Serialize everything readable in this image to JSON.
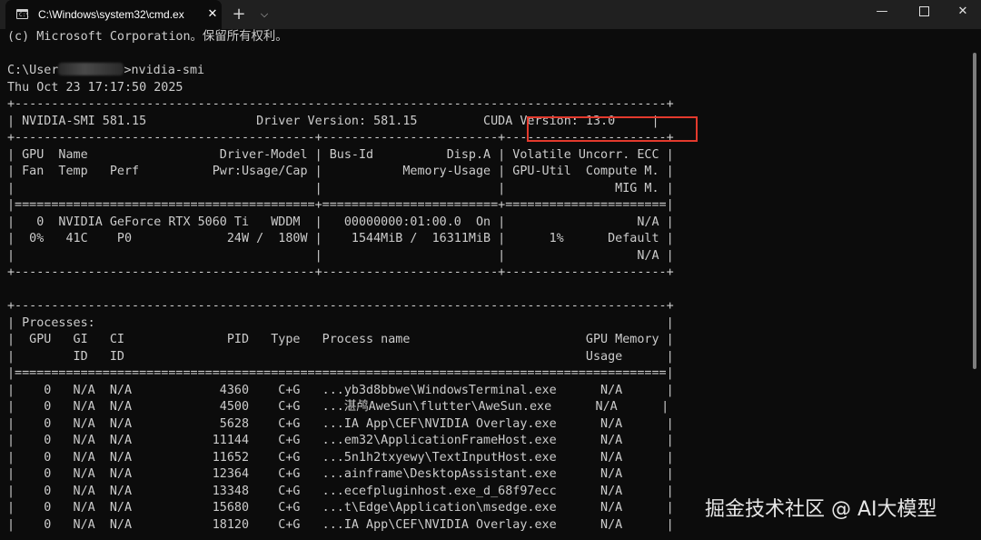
{
  "window": {
    "tab_title": "C:\\Windows\\system32\\cmd.ex",
    "tab_icon_glyph": "C:\\",
    "tab_close": "✕",
    "new_tab": "+",
    "tab_dropdown": "⌵",
    "minimize": "—",
    "close": "✕"
  },
  "console": {
    "copyright": "(c) Microsoft Corporation。保留所有权利。",
    "prompt_prefix": "C:\\User",
    "command": ">nvidia-smi",
    "timestamp": "Thu Oct 23 17:17:50 2025",
    "border_top": "+-----------------------------------------------------------------------------------------+",
    "header_line": "| NVIDIA-SMI 581.15               Driver Version: 581.15         CUDA Version: 13.0     |",
    "border_sections": "+-----------------------------------------+------------------------+----------------------+",
    "col_header_1": "| GPU  Name                  Driver-Model | Bus-Id          Disp.A | Volatile Uncorr. ECC |",
    "col_header_2": "| Fan  Temp   Perf          Pwr:Usage/Cap |           Memory-Usage | GPU-Util  Compute M. |",
    "col_header_3": "|                                         |                        |               MIG M. |",
    "border_double": "|=========================================+========================+======================|",
    "gpu_row_1": "|   0  NVIDIA GeForce RTX 5060 Ti   WDDM  |   00000000:01:00.0  On |                  N/A |",
    "gpu_row_2": "|  0%   41C    P0             24W /  180W |    1544MiB /  16311MiB |      1%      Default |",
    "gpu_row_3": "|                                         |                        |                  N/A |",
    "border_bottom": "+-----------------------------------------+------------------------+----------------------+",
    "blank": " ",
    "proc_border_top": "+-----------------------------------------------------------------------------------------+",
    "proc_title": "| Processes:                                                                              |",
    "proc_header_1": "|  GPU   GI   CI              PID   Type   Process name                        GPU Memory |",
    "proc_header_2": "|        ID   ID                                                               Usage      |",
    "proc_border_double": "|=========================================================================================|",
    "processes": [
      "|    0   N/A  N/A            4360    C+G   ...yb3d8bbwe\\WindowsTerminal.exe      N/A      |",
      "|    0   N/A  N/A            4500    C+G   ...湛鸬AweSun\\flutter\\AweSun.exe      N/A      |",
      "|    0   N/A  N/A            5628    C+G   ...IA App\\CEF\\NVIDIA Overlay.exe      N/A      |",
      "|    0   N/A  N/A           11144    C+G   ...em32\\ApplicationFrameHost.exe      N/A      |",
      "|    0   N/A  N/A           11652    C+G   ...5n1h2txyewy\\TextInputHost.exe      N/A      |",
      "|    0   N/A  N/A           12364    C+G   ...ainframe\\DesktopAssistant.exe      N/A      |",
      "|    0   N/A  N/A           13348    C+G   ...ecefpluginhost.exe_d_68f97ecc      N/A      |",
      "|    0   N/A  N/A           15680    C+G   ...t\\Edge\\Application\\msedge.exe      N/A      |",
      "|    0   N/A  N/A           18120    C+G   ...IA App\\CEF\\NVIDIA Overlay.exe      N/A      |"
    ]
  },
  "watermark": "掘金技术社区 @ AI大模型",
  "colors": {
    "background": "#0c0c0c",
    "text": "#cccccc",
    "highlight": "#e33a2d"
  }
}
